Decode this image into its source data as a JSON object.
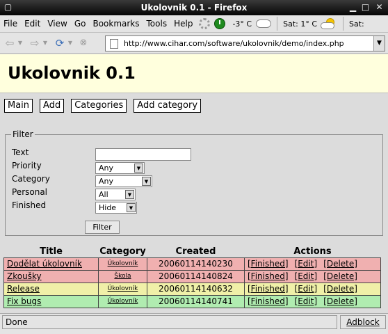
{
  "window": {
    "title": "Ukolovnik 0.1 - Firefox"
  },
  "menu": [
    "File",
    "Edit",
    "View",
    "Go",
    "Bookmarks",
    "Tools",
    "Help"
  ],
  "weather": {
    "current": "-3° C",
    "forecast1": "Sat: 1° C",
    "forecast2": "Sat:"
  },
  "address": {
    "url": "http://www.cihar.com/software/ukolovnik/demo/index.php"
  },
  "page": {
    "title": "Ukolovnik 0.1",
    "nav": [
      "Main",
      "Add",
      "Categories",
      "Add category"
    ]
  },
  "filter": {
    "legend": "Filter",
    "text_label": "Text",
    "text_value": "",
    "priority_label": "Priority",
    "priority_value": "Any",
    "category_label": "Category",
    "category_value": "Any",
    "personal_label": "Personal",
    "personal_value": "All",
    "finished_label": "Finished",
    "finished_value": "Hide",
    "button": "Filter"
  },
  "table": {
    "headers": [
      "Title",
      "Category",
      "Created",
      "Actions"
    ],
    "actions": [
      "[Finished]",
      "[Edit]",
      "[Delete]"
    ],
    "rows": [
      {
        "title": "Dodělat úkolovník",
        "category": "Úkolovník",
        "created": "20060114140230",
        "color": "#f0b0b0"
      },
      {
        "title": "Zkoušky",
        "category": "Škola",
        "created": "20060114140824",
        "color": "#f0b0b0"
      },
      {
        "title": "Release",
        "category": "Úkolovník",
        "created": "20060114140632",
        "color": "#f0f0a8"
      },
      {
        "title": "Fix bugs",
        "category": "Úkolovník",
        "created": "20060114140741",
        "color": "#b0ecb0"
      }
    ]
  },
  "status": {
    "text": "Done",
    "addon": "Adblock"
  }
}
